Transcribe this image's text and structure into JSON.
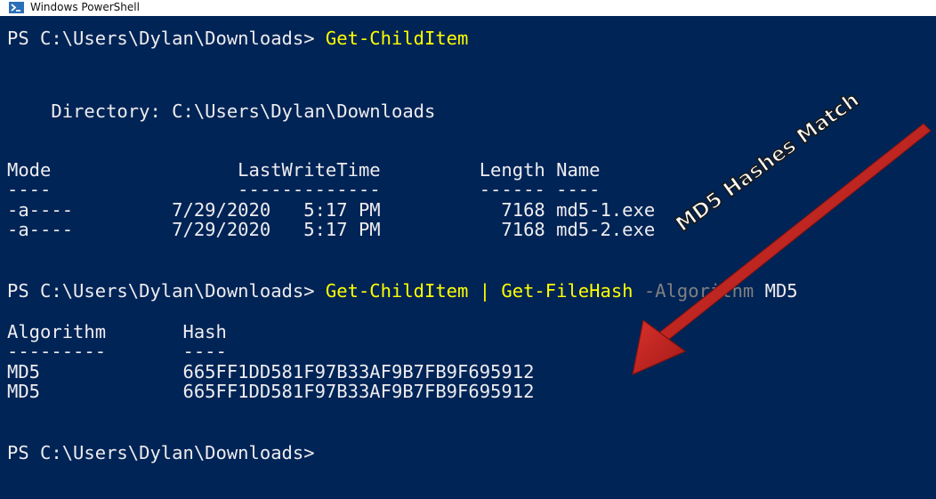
{
  "window": {
    "title": "Windows PowerShell",
    "icon": "powershell-icon"
  },
  "console": {
    "background": "#012456",
    "text_color": "#eeedf0",
    "command_color": "#ffff00",
    "parameter_color": "#808080",
    "prompt": "PS C:\\Users\\Dylan\\Downloads> ",
    "cmd1": "Get-ChildItem",
    "directory_line": "    Directory: C:\\Users\\Dylan\\Downloads",
    "table1_header": "Mode                 LastWriteTime         Length Name",
    "table1_underline": "----                 -------------         ------ ----",
    "file_rows": [
      "-a----         7/29/2020   5:17 PM           7168 md5-1.exe",
      "-a----         7/29/2020   5:17 PM           7168 md5-2.exe"
    ],
    "cmd2_part1": "Get-ChildItem",
    "cmd2_pipe": " | ",
    "cmd2_part2": "Get-FileHash",
    "cmd2_param": " -Algorithm",
    "cmd2_value": " MD5",
    "table2_header": "Algorithm       Hash",
    "table2_underline": "---------       ----",
    "hash_rows": [
      "MD5             665FF1DD581F97B33AF9B7FB9F695912",
      "MD5             665FF1DD581F97B33AF9B7FB9F695912"
    ],
    "final_prompt": "PS C:\\Users\\Dylan\\Downloads>"
  },
  "annotation": {
    "text": "MD5 Hashes Match",
    "arrow_color": "#c0201c"
  }
}
